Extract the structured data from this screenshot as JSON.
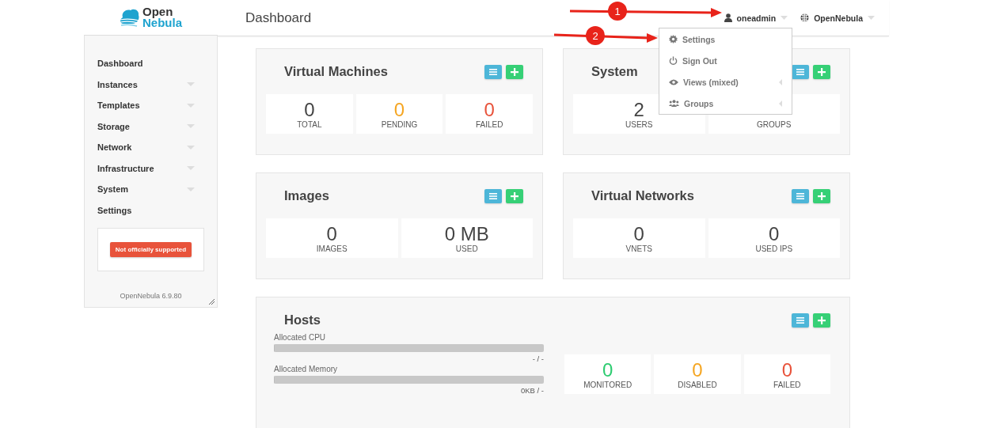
{
  "logo": {
    "word_1": "Open",
    "word_2": "Nebula"
  },
  "header": {
    "title": "Dashboard",
    "user": "oneadmin",
    "zone": "OpenNebula"
  },
  "user_menu": [
    {
      "kind": "gear",
      "label": "Settings",
      "submenu": false
    },
    {
      "kind": "power",
      "label": "Sign Out",
      "submenu": false
    },
    {
      "kind": "eye",
      "label": "Views (mixed)",
      "submenu": true
    },
    {
      "kind": "group",
      "label": "Groups",
      "submenu": true
    }
  ],
  "annotations": [
    {
      "number": "1"
    },
    {
      "number": "2"
    }
  ],
  "sidebar": {
    "items": [
      {
        "label": "Dashboard",
        "expandable": false
      },
      {
        "label": "Instances",
        "expandable": true
      },
      {
        "label": "Templates",
        "expandable": true
      },
      {
        "label": "Storage",
        "expandable": true
      },
      {
        "label": "Network",
        "expandable": true
      },
      {
        "label": "Infrastructure",
        "expandable": true
      },
      {
        "label": "System",
        "expandable": true
      },
      {
        "label": "Settings",
        "expandable": false
      }
    ],
    "badge": "Not officially supported",
    "version": "OpenNebula 6.9.80"
  },
  "cards": [
    {
      "title": "Virtual Machines",
      "stats": [
        {
          "value": "0",
          "label": "TOTAL"
        },
        {
          "value": "0",
          "label": "PENDING",
          "color": "#f5a623"
        },
        {
          "value": "0",
          "label": "FAILED",
          "color": "#e8533b"
        }
      ]
    },
    {
      "title": "System",
      "stats": [
        {
          "value": "2",
          "label": "USERS"
        },
        {
          "label": "GROUPS"
        }
      ]
    },
    {
      "title": "Images",
      "stats": [
        {
          "value": "0",
          "label": "IMAGES"
        },
        {
          "value": "0 MB",
          "label": "USED"
        }
      ]
    },
    {
      "title": "Virtual Networks",
      "stats": [
        {
          "value": "0",
          "label": "VNETS"
        },
        {
          "value": "0",
          "label": "USED IPS"
        }
      ]
    }
  ],
  "hosts": {
    "title": "Hosts",
    "meters": [
      {
        "label": "Allocated CPU",
        "level": 0,
        "reading": "- / -"
      },
      {
        "label": "Allocated Memory",
        "level": 0,
        "reading": "0KB / -"
      }
    ],
    "stats": [
      {
        "value": "0",
        "label": "MONITORED",
        "color": "#2ecc71"
      },
      {
        "value": "0",
        "label": "DISABLED",
        "color": "#f5a623"
      },
      {
        "value": "0",
        "label": "FAILED",
        "color": "#e8533b"
      }
    ]
  }
}
